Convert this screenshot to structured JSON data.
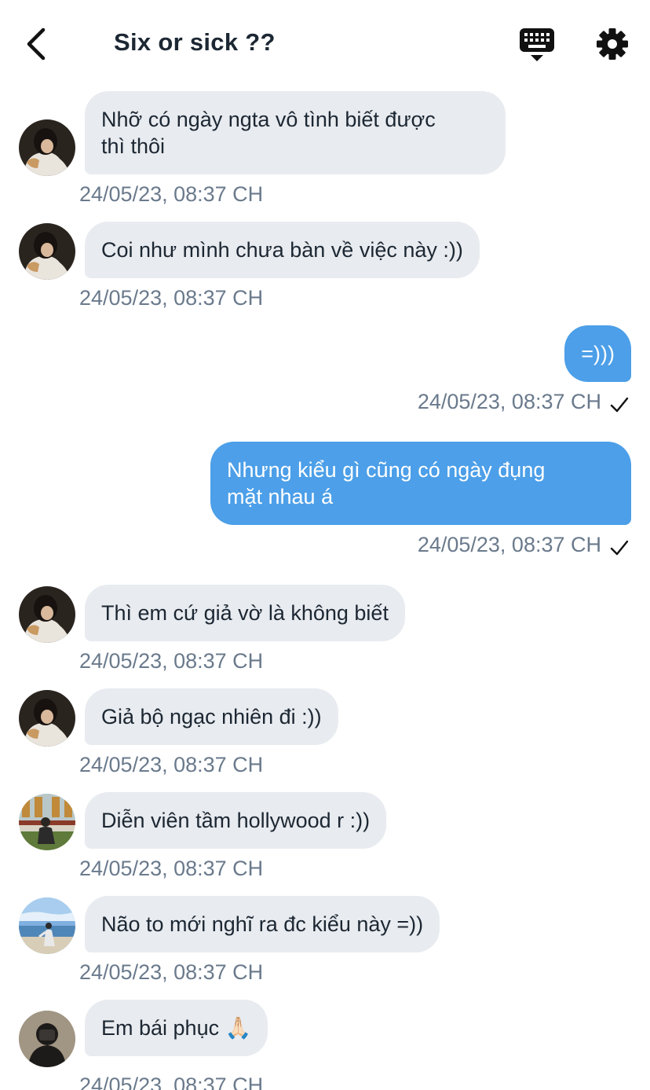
{
  "header": {
    "title": "Six or sick ??",
    "back_icon": "chevron-left-icon",
    "keyboard_icon": "keyboard-icon",
    "settings_icon": "gear-icon"
  },
  "colors": {
    "incoming_bubble": "#e8ebef",
    "outgoing_bubble": "#4c9fe8",
    "timestamp": "#6a7a8c",
    "text": "#1c2733"
  },
  "messages": [
    {
      "direction": "in",
      "avatar": "user-a",
      "text": "Nhỡ có ngày ngta vô tình biết được\nthì thôi",
      "time": "24/05/23, 08:37 CH"
    },
    {
      "direction": "in",
      "avatar": "user-a",
      "text": "Coi như mình chưa bàn về việc này :))",
      "time": "24/05/23, 08:37 CH"
    },
    {
      "direction": "out",
      "text": "=)))",
      "time": "24/05/23, 08:37 CH",
      "status": "sent"
    },
    {
      "direction": "out",
      "text": "Nhưng kiểu gì cũng có ngày đụng\nmặt nhau á",
      "time": "24/05/23, 08:37 CH",
      "status": "sent"
    },
    {
      "direction": "in",
      "avatar": "user-a",
      "text": "Thì em cứ giả vờ là không biết",
      "time": "24/05/23, 08:37 CH"
    },
    {
      "direction": "in",
      "avatar": "user-a",
      "text": "Giả bộ ngạc nhiên đi :))",
      "time": "24/05/23, 08:37 CH"
    },
    {
      "direction": "in",
      "avatar": "user-b",
      "text": "Diễn viên tầm hollywood r :))",
      "time": "24/05/23, 08:37 CH"
    },
    {
      "direction": "in",
      "avatar": "user-c",
      "text": "Não to mới nghĩ ra đc kiểu này =))",
      "time": "24/05/23, 08:37 CH"
    },
    {
      "direction": "in",
      "avatar": "user-d",
      "text": "Em bái phục 🙏🏻",
      "time": "24/05/23, 08:37 CH"
    }
  ]
}
